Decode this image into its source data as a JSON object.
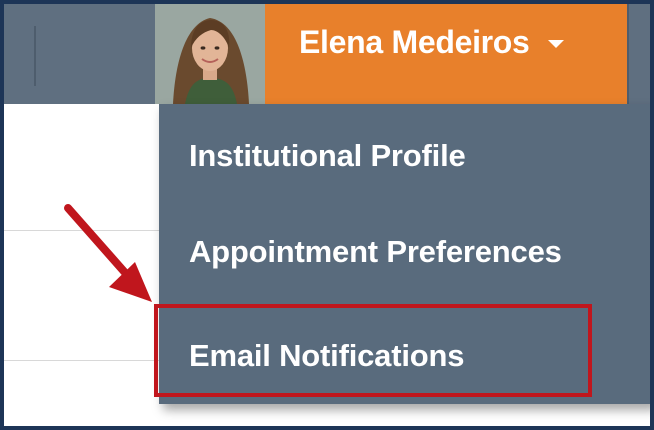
{
  "header": {
    "user": {
      "name": "Elena Medeiros",
      "avatar_icon": "person-avatar-icon",
      "dropdown_icon": "caret-down-icon"
    }
  },
  "user_menu": {
    "items": [
      {
        "label": "Institutional Profile"
      },
      {
        "label": "Appointment Preferences"
      },
      {
        "label": "Email Notifications"
      }
    ],
    "highlighted_item": "Email Notifications"
  },
  "annotation": {
    "arrow_icon": "red-pointer-arrow-icon",
    "highlight_color": "#c0161d"
  },
  "colors": {
    "accent": "#e8802b",
    "topbar": "#5f6f80",
    "menu_background": "#596b7d",
    "frame_border": "#1d3557"
  }
}
